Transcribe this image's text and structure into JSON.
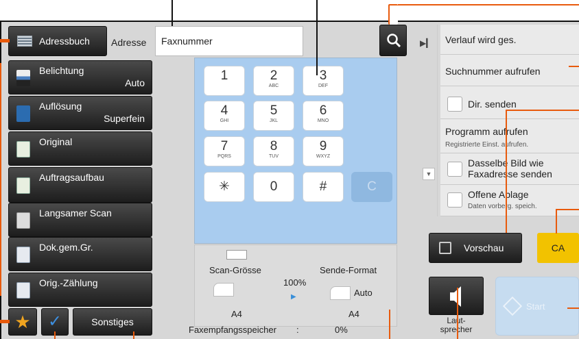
{
  "toolbar": {
    "address_book": "Adressbuch",
    "address_label": "Adresse",
    "fax_placeholder": "Faxnummer"
  },
  "functions": [
    {
      "label": "Belichtung",
      "value": "Auto",
      "icon": "exposure-icon"
    },
    {
      "label": "Auflösung",
      "value": "Superfein",
      "icon": "resolution-icon"
    },
    {
      "label": "Original",
      "value": "",
      "icon": "original-icon"
    },
    {
      "label": "Auftragsaufbau",
      "value": "",
      "icon": "job-build-icon"
    },
    {
      "label": "Langsamer Scan",
      "value": "",
      "icon": "slow-scan-icon"
    },
    {
      "label": "Dok.gem.Gr.",
      "value": "",
      "icon": "mixed-size-icon"
    },
    {
      "label": "Orig.-Zählung",
      "value": "",
      "icon": "count-icon"
    }
  ],
  "bottom_left": {
    "other": "Sonstiges"
  },
  "keypad": {
    "keys": [
      {
        "digit": "1",
        "sub": ""
      },
      {
        "digit": "2",
        "sub": "ABC"
      },
      {
        "digit": "3",
        "sub": "DEF"
      },
      {
        "digit": "4",
        "sub": "GHI"
      },
      {
        "digit": "5",
        "sub": "JKL"
      },
      {
        "digit": "6",
        "sub": "MNO"
      },
      {
        "digit": "7",
        "sub": "PQRS"
      },
      {
        "digit": "8",
        "sub": "TUV"
      },
      {
        "digit": "9",
        "sub": "WXYZ"
      },
      {
        "digit": "✳",
        "sub": ""
      },
      {
        "digit": "0",
        "sub": ""
      },
      {
        "digit": "#",
        "sub": ""
      }
    ],
    "clear": "C"
  },
  "scan": {
    "scan_size_label": "Scan-Grösse",
    "send_format_label": "Sende-Format",
    "ratio": "100%",
    "send_auto": "Auto",
    "scan_paper": "A4",
    "send_paper": "A4",
    "memory_label": "Faxempfangsspeicher",
    "memory_sep": ":",
    "memory_value": "0%"
  },
  "right": {
    "history": "Verlauf wird ges.",
    "call_number": "Suchnummer aufrufen",
    "direct_send": "Dir. senden",
    "program_title": "Programm aufrufen",
    "program_sub": "Registrierte Einst. aufrufen.",
    "same_image_l1": "Dasselbe Bild wie",
    "same_image_l2": "Faxadresse senden",
    "open_l1": "Offene Ablage",
    "open_sub": "Daten vorberg. speich."
  },
  "actions": {
    "preview": "Vorschau",
    "ca": "CA",
    "speaker_l1": "Laut-",
    "speaker_l2": "sprecher",
    "start": "Start"
  },
  "colors": {
    "accent": "#e85a0c",
    "ca": "#f2c200",
    "keypad": "#a9ccef"
  }
}
